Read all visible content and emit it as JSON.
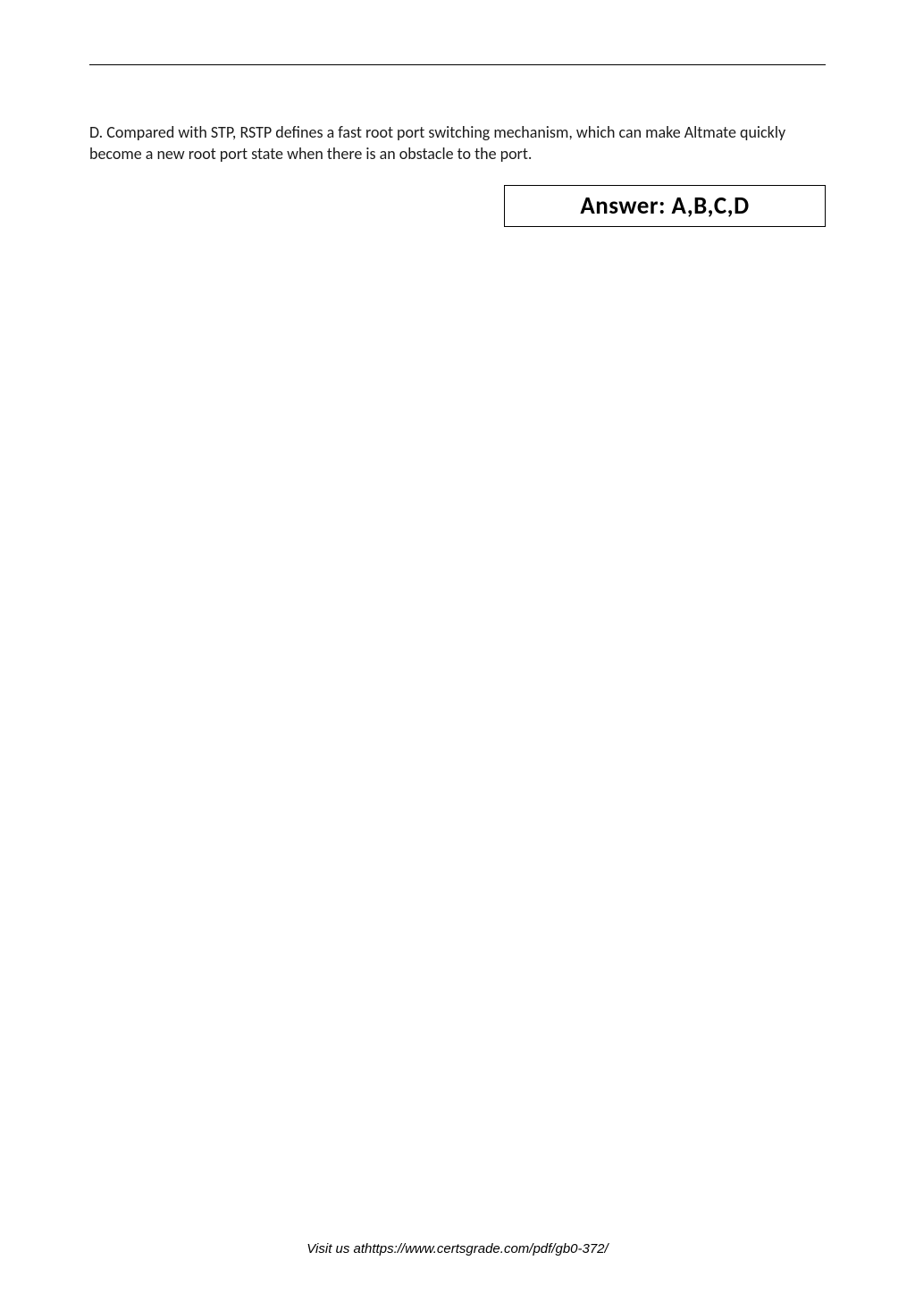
{
  "option": {
    "letter": "D.",
    "text": "Compared with STP, RSTP defines a fast root port switching mechanism, which can make Altmate quickly become a new root port state when there is an obstacle to the port."
  },
  "answer": {
    "label": "Answer: A,B,C,D"
  },
  "footer": {
    "text": "Visit us athttps://www.certsgrade.com/pdf/gb0-372/"
  }
}
